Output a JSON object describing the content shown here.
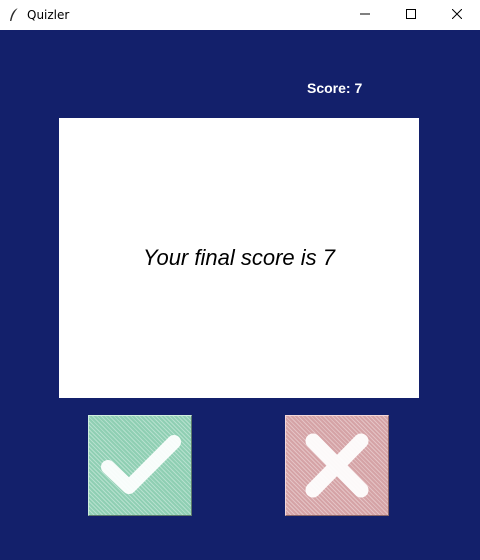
{
  "window": {
    "title": "Quizler",
    "icon": "feather-icon",
    "controls": [
      "minimize-icon",
      "maximize-icon",
      "close-icon"
    ]
  },
  "score": {
    "label": "Score: 7"
  },
  "question": {
    "text": "Your final score is 7"
  },
  "buttons": {
    "true_icon": "checkmark-icon",
    "false_icon": "cross-icon"
  },
  "colors": {
    "background": "#13206b",
    "card": "#ffffff",
    "true_button": "#8fcfb3",
    "false_button": "#d5a3a6"
  }
}
